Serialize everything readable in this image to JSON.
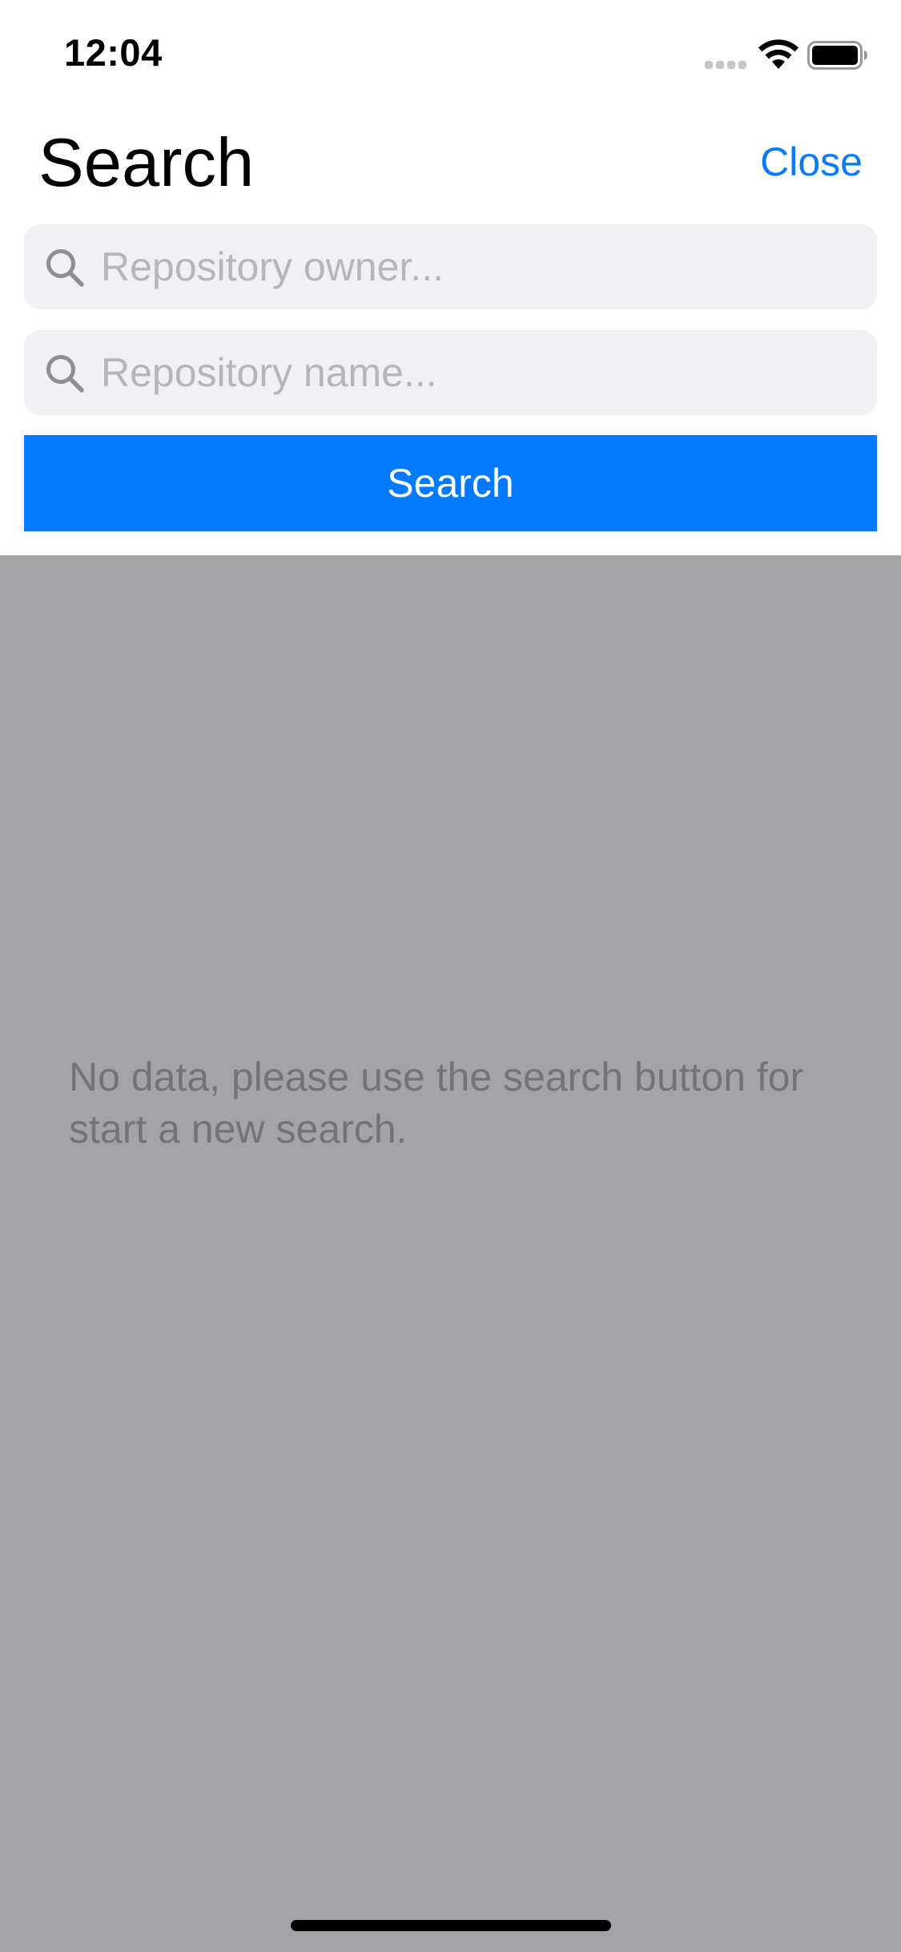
{
  "status_bar": {
    "time": "12:04",
    "signal_icon": "cellular-signal-icon",
    "wifi_icon": "wifi-icon",
    "battery_icon": "battery-icon"
  },
  "header": {
    "title": "Search",
    "close_label": "Close"
  },
  "search_form": {
    "owner_field": {
      "placeholder": "Repository owner...",
      "value": "",
      "icon": "search-icon"
    },
    "name_field": {
      "placeholder": "Repository name...",
      "value": "",
      "icon": "search-icon"
    },
    "submit_label": "Search"
  },
  "empty_state": {
    "message": "No data, please use the search button for start a new search."
  },
  "colors": {
    "accent": "#017aff",
    "link": "#0a7aff",
    "field_background": "#f0f0f5",
    "overlay_background": "#a4a3a8",
    "placeholder": "#b5b5ba",
    "empty_text": "#737378"
  }
}
